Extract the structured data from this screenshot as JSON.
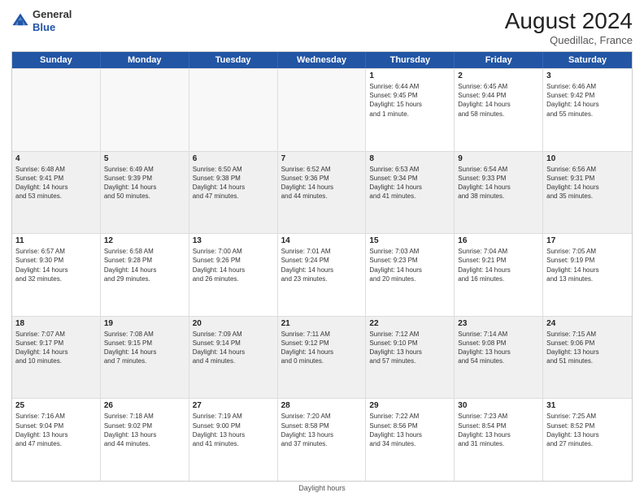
{
  "header": {
    "logo_general": "General",
    "logo_blue": "Blue",
    "month_year": "August 2024",
    "location": "Quedillac, France"
  },
  "weekdays": [
    "Sunday",
    "Monday",
    "Tuesday",
    "Wednesday",
    "Thursday",
    "Friday",
    "Saturday"
  ],
  "footer": "Daylight hours",
  "rows": [
    [
      {
        "day": "",
        "info": "",
        "empty": true
      },
      {
        "day": "",
        "info": "",
        "empty": true
      },
      {
        "day": "",
        "info": "",
        "empty": true
      },
      {
        "day": "",
        "info": "",
        "empty": true
      },
      {
        "day": "1",
        "info": "Sunrise: 6:44 AM\nSunset: 9:45 PM\nDaylight: 15 hours\nand 1 minute.",
        "empty": false
      },
      {
        "day": "2",
        "info": "Sunrise: 6:45 AM\nSunset: 9:44 PM\nDaylight: 14 hours\nand 58 minutes.",
        "empty": false
      },
      {
        "day": "3",
        "info": "Sunrise: 6:46 AM\nSunset: 9:42 PM\nDaylight: 14 hours\nand 55 minutes.",
        "empty": false
      }
    ],
    [
      {
        "day": "4",
        "info": "Sunrise: 6:48 AM\nSunset: 9:41 PM\nDaylight: 14 hours\nand 53 minutes.",
        "empty": false
      },
      {
        "day": "5",
        "info": "Sunrise: 6:49 AM\nSunset: 9:39 PM\nDaylight: 14 hours\nand 50 minutes.",
        "empty": false
      },
      {
        "day": "6",
        "info": "Sunrise: 6:50 AM\nSunset: 9:38 PM\nDaylight: 14 hours\nand 47 minutes.",
        "empty": false
      },
      {
        "day": "7",
        "info": "Sunrise: 6:52 AM\nSunset: 9:36 PM\nDaylight: 14 hours\nand 44 minutes.",
        "empty": false
      },
      {
        "day": "8",
        "info": "Sunrise: 6:53 AM\nSunset: 9:34 PM\nDaylight: 14 hours\nand 41 minutes.",
        "empty": false
      },
      {
        "day": "9",
        "info": "Sunrise: 6:54 AM\nSunset: 9:33 PM\nDaylight: 14 hours\nand 38 minutes.",
        "empty": false
      },
      {
        "day": "10",
        "info": "Sunrise: 6:56 AM\nSunset: 9:31 PM\nDaylight: 14 hours\nand 35 minutes.",
        "empty": false
      }
    ],
    [
      {
        "day": "11",
        "info": "Sunrise: 6:57 AM\nSunset: 9:30 PM\nDaylight: 14 hours\nand 32 minutes.",
        "empty": false
      },
      {
        "day": "12",
        "info": "Sunrise: 6:58 AM\nSunset: 9:28 PM\nDaylight: 14 hours\nand 29 minutes.",
        "empty": false
      },
      {
        "day": "13",
        "info": "Sunrise: 7:00 AM\nSunset: 9:26 PM\nDaylight: 14 hours\nand 26 minutes.",
        "empty": false
      },
      {
        "day": "14",
        "info": "Sunrise: 7:01 AM\nSunset: 9:24 PM\nDaylight: 14 hours\nand 23 minutes.",
        "empty": false
      },
      {
        "day": "15",
        "info": "Sunrise: 7:03 AM\nSunset: 9:23 PM\nDaylight: 14 hours\nand 20 minutes.",
        "empty": false
      },
      {
        "day": "16",
        "info": "Sunrise: 7:04 AM\nSunset: 9:21 PM\nDaylight: 14 hours\nand 16 minutes.",
        "empty": false
      },
      {
        "day": "17",
        "info": "Sunrise: 7:05 AM\nSunset: 9:19 PM\nDaylight: 14 hours\nand 13 minutes.",
        "empty": false
      }
    ],
    [
      {
        "day": "18",
        "info": "Sunrise: 7:07 AM\nSunset: 9:17 PM\nDaylight: 14 hours\nand 10 minutes.",
        "empty": false
      },
      {
        "day": "19",
        "info": "Sunrise: 7:08 AM\nSunset: 9:15 PM\nDaylight: 14 hours\nand 7 minutes.",
        "empty": false
      },
      {
        "day": "20",
        "info": "Sunrise: 7:09 AM\nSunset: 9:14 PM\nDaylight: 14 hours\nand 4 minutes.",
        "empty": false
      },
      {
        "day": "21",
        "info": "Sunrise: 7:11 AM\nSunset: 9:12 PM\nDaylight: 14 hours\nand 0 minutes.",
        "empty": false
      },
      {
        "day": "22",
        "info": "Sunrise: 7:12 AM\nSunset: 9:10 PM\nDaylight: 13 hours\nand 57 minutes.",
        "empty": false
      },
      {
        "day": "23",
        "info": "Sunrise: 7:14 AM\nSunset: 9:08 PM\nDaylight: 13 hours\nand 54 minutes.",
        "empty": false
      },
      {
        "day": "24",
        "info": "Sunrise: 7:15 AM\nSunset: 9:06 PM\nDaylight: 13 hours\nand 51 minutes.",
        "empty": false
      }
    ],
    [
      {
        "day": "25",
        "info": "Sunrise: 7:16 AM\nSunset: 9:04 PM\nDaylight: 13 hours\nand 47 minutes.",
        "empty": false
      },
      {
        "day": "26",
        "info": "Sunrise: 7:18 AM\nSunset: 9:02 PM\nDaylight: 13 hours\nand 44 minutes.",
        "empty": false
      },
      {
        "day": "27",
        "info": "Sunrise: 7:19 AM\nSunset: 9:00 PM\nDaylight: 13 hours\nand 41 minutes.",
        "empty": false
      },
      {
        "day": "28",
        "info": "Sunrise: 7:20 AM\nSunset: 8:58 PM\nDaylight: 13 hours\nand 37 minutes.",
        "empty": false
      },
      {
        "day": "29",
        "info": "Sunrise: 7:22 AM\nSunset: 8:56 PM\nDaylight: 13 hours\nand 34 minutes.",
        "empty": false
      },
      {
        "day": "30",
        "info": "Sunrise: 7:23 AM\nSunset: 8:54 PM\nDaylight: 13 hours\nand 31 minutes.",
        "empty": false
      },
      {
        "day": "31",
        "info": "Sunrise: 7:25 AM\nSunset: 8:52 PM\nDaylight: 13 hours\nand 27 minutes.",
        "empty": false
      }
    ]
  ]
}
